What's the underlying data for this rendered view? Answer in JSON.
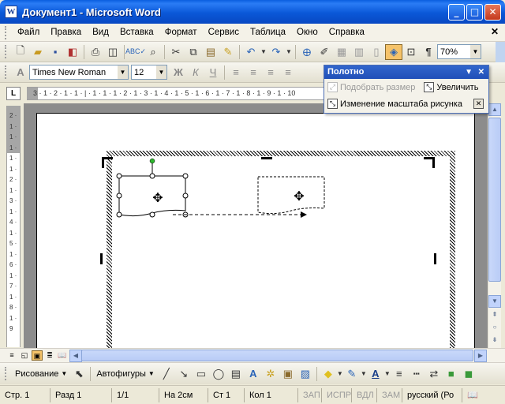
{
  "window": {
    "title": "Документ1 - Microsoft Word",
    "icon_letter": "W"
  },
  "menu": {
    "items": [
      "Файл",
      "Правка",
      "Вид",
      "Вставка",
      "Формат",
      "Сервис",
      "Таблица",
      "Окно",
      "Справка"
    ]
  },
  "toolbar_standard": {
    "zoom_value": "70%"
  },
  "toolbar_formatting": {
    "font_name": "Times New Roman",
    "font_size": "12",
    "bold_label": "Ж",
    "italic_label": "К",
    "underline_label": "Ч"
  },
  "ruler": {
    "corner_label": "L",
    "h_numbers": "3 · 1 · 2 · 1 · 1 · | · 1 · 1 · 1 · 2 · 1 · 3 · 1 · 4 · 1 · 5 · 1 · 6 · 1 · 7 · 1 · 8 · 1 · 9 · 1 · 10",
    "v_numbers": "2 · 1 · 1 · 1 · 1 · 1 · 2 · 1 · 3 · 1 · 4 · 1 · 5 · 1 · 6 · 1 · 7 · 1 · 8 · 1 · 9"
  },
  "canvas_panel": {
    "title": "Полотно",
    "fit_label": "Подобрать размер",
    "enlarge_label": "Увеличить",
    "scale_label": "Изменение масштаба рисунка"
  },
  "drawing_toolbar": {
    "draw_label": "Рисование",
    "autoshapes_label": "Автофигуры"
  },
  "status": {
    "page": "Стр. 1",
    "section": "Разд 1",
    "page_of": "1/1",
    "at": "На 2см",
    "line": "Ст 1",
    "col": "Кол 1",
    "rec": "ЗАП",
    "trk": "ИСПР",
    "ext": "ВДЛ",
    "ovr": "ЗАМ",
    "language": "русский (Ро"
  },
  "colors": {
    "title_bar": "#0A58D8",
    "panel_title": "#2050B8",
    "handle_rotate": "#2EB82E"
  }
}
